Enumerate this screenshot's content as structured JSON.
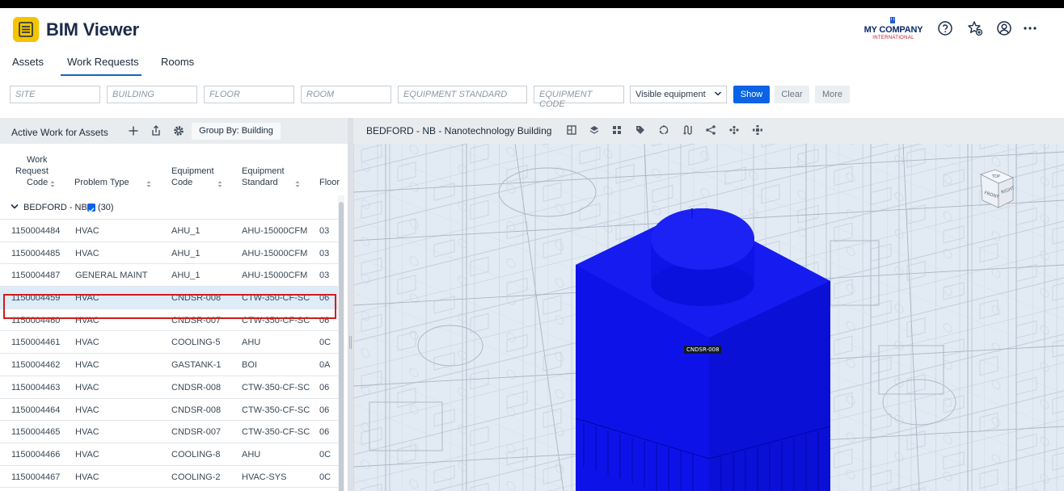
{
  "header": {
    "title": "BIM Viewer",
    "company_name": "MY COMPANY",
    "company_sub": "INTERNATIONAL",
    "icons": [
      "help-icon",
      "favorite-star-icon",
      "user-account-icon",
      "more-options-icon"
    ]
  },
  "tabs": [
    {
      "label": "Assets",
      "active": false
    },
    {
      "label": "Work Requests",
      "active": true
    },
    {
      "label": "Rooms",
      "active": false
    }
  ],
  "filters": {
    "site_placeholder": "SITE",
    "building_placeholder": "BUILDING",
    "floor_placeholder": "FLOOR",
    "room_placeholder": "ROOM",
    "equipment_standard_placeholder": "EQUIPMENT STANDARD",
    "equipment_code_placeholder": "EQUIPMENT CODE",
    "visibility_select": "Visible equipment",
    "show_label": "Show",
    "clear_label": "Clear",
    "more_label": "More"
  },
  "panel": {
    "title": "Active Work for Assets",
    "group_by_label": "Group By: Building",
    "columns": {
      "work_request_code": [
        "Work",
        "Request",
        "Code"
      ],
      "problem_type": "Problem Type",
      "equipment_code": [
        "Equipment",
        "Code"
      ],
      "equipment_standard": [
        "Equipment",
        "Standard"
      ],
      "floor": "Floor"
    },
    "group": {
      "label": "BEDFORD - NB",
      "count": "(30)"
    },
    "rows": [
      {
        "code": "1150004484",
        "problem": "HVAC",
        "equip": "AHU_1",
        "standard": "AHU-15000CFM",
        "floor": "03",
        "selected": false
      },
      {
        "code": "1150004485",
        "problem": "HVAC",
        "equip": "AHU_1",
        "standard": "AHU-15000CFM",
        "floor": "03",
        "selected": false
      },
      {
        "code": "1150004487",
        "problem": "GENERAL MAINT",
        "equip": "AHU_1",
        "standard": "AHU-15000CFM",
        "floor": "03",
        "selected": false
      },
      {
        "code": "1150004459",
        "problem": "HVAC",
        "equip": "CNDSR-008",
        "standard": "CTW-350-CF-SC",
        "floor": "06",
        "selected": true
      },
      {
        "code": "1150004460",
        "problem": "HVAC",
        "equip": "CNDSR-007",
        "standard": "CTW-350-CF-SC",
        "floor": "06",
        "selected": false
      },
      {
        "code": "1150004461",
        "problem": "HVAC",
        "equip": "COOLING-5",
        "standard": "AHU",
        "floor": "0C",
        "selected": false
      },
      {
        "code": "1150004462",
        "problem": "HVAC",
        "equip": "GASTANK-1",
        "standard": "BOI",
        "floor": "0A",
        "selected": false
      },
      {
        "code": "1150004463",
        "problem": "HVAC",
        "equip": "CNDSR-008",
        "standard": "CTW-350-CF-SC",
        "floor": "06",
        "selected": false
      },
      {
        "code": "1150004464",
        "problem": "HVAC",
        "equip": "CNDSR-008",
        "standard": "CTW-350-CF-SC",
        "floor": "06",
        "selected": false
      },
      {
        "code": "1150004465",
        "problem": "HVAC",
        "equip": "CNDSR-007",
        "standard": "CTW-350-CF-SC",
        "floor": "06",
        "selected": false
      },
      {
        "code": "1150004466",
        "problem": "HVAC",
        "equip": "COOLING-8",
        "standard": "AHU",
        "floor": "0C",
        "selected": false
      },
      {
        "code": "1150004467",
        "problem": "HVAC",
        "equip": "COOLING-2",
        "standard": "HVAC-SYS",
        "floor": "0C",
        "selected": false
      }
    ]
  },
  "viewer": {
    "title": "BEDFORD - NB - Nanotechnology Building",
    "selected_tag": "CNDSR-008",
    "cube_faces": {
      "top": "TOP",
      "front": "FRONT",
      "right": "RIGHT"
    },
    "model_color": "#0a10e6",
    "toolbar_icons": [
      "floor-plan-icon",
      "layers-icon",
      "grid-icon",
      "tag-icon",
      "rotate-icon",
      "section-icon",
      "share-icon",
      "network-icon",
      "explode-icon"
    ]
  },
  "colors": {
    "accent": "#0b63e5",
    "selection_outline": "#d01c1c",
    "selected_row": "#deebf8",
    "logo": "#f5c400"
  }
}
